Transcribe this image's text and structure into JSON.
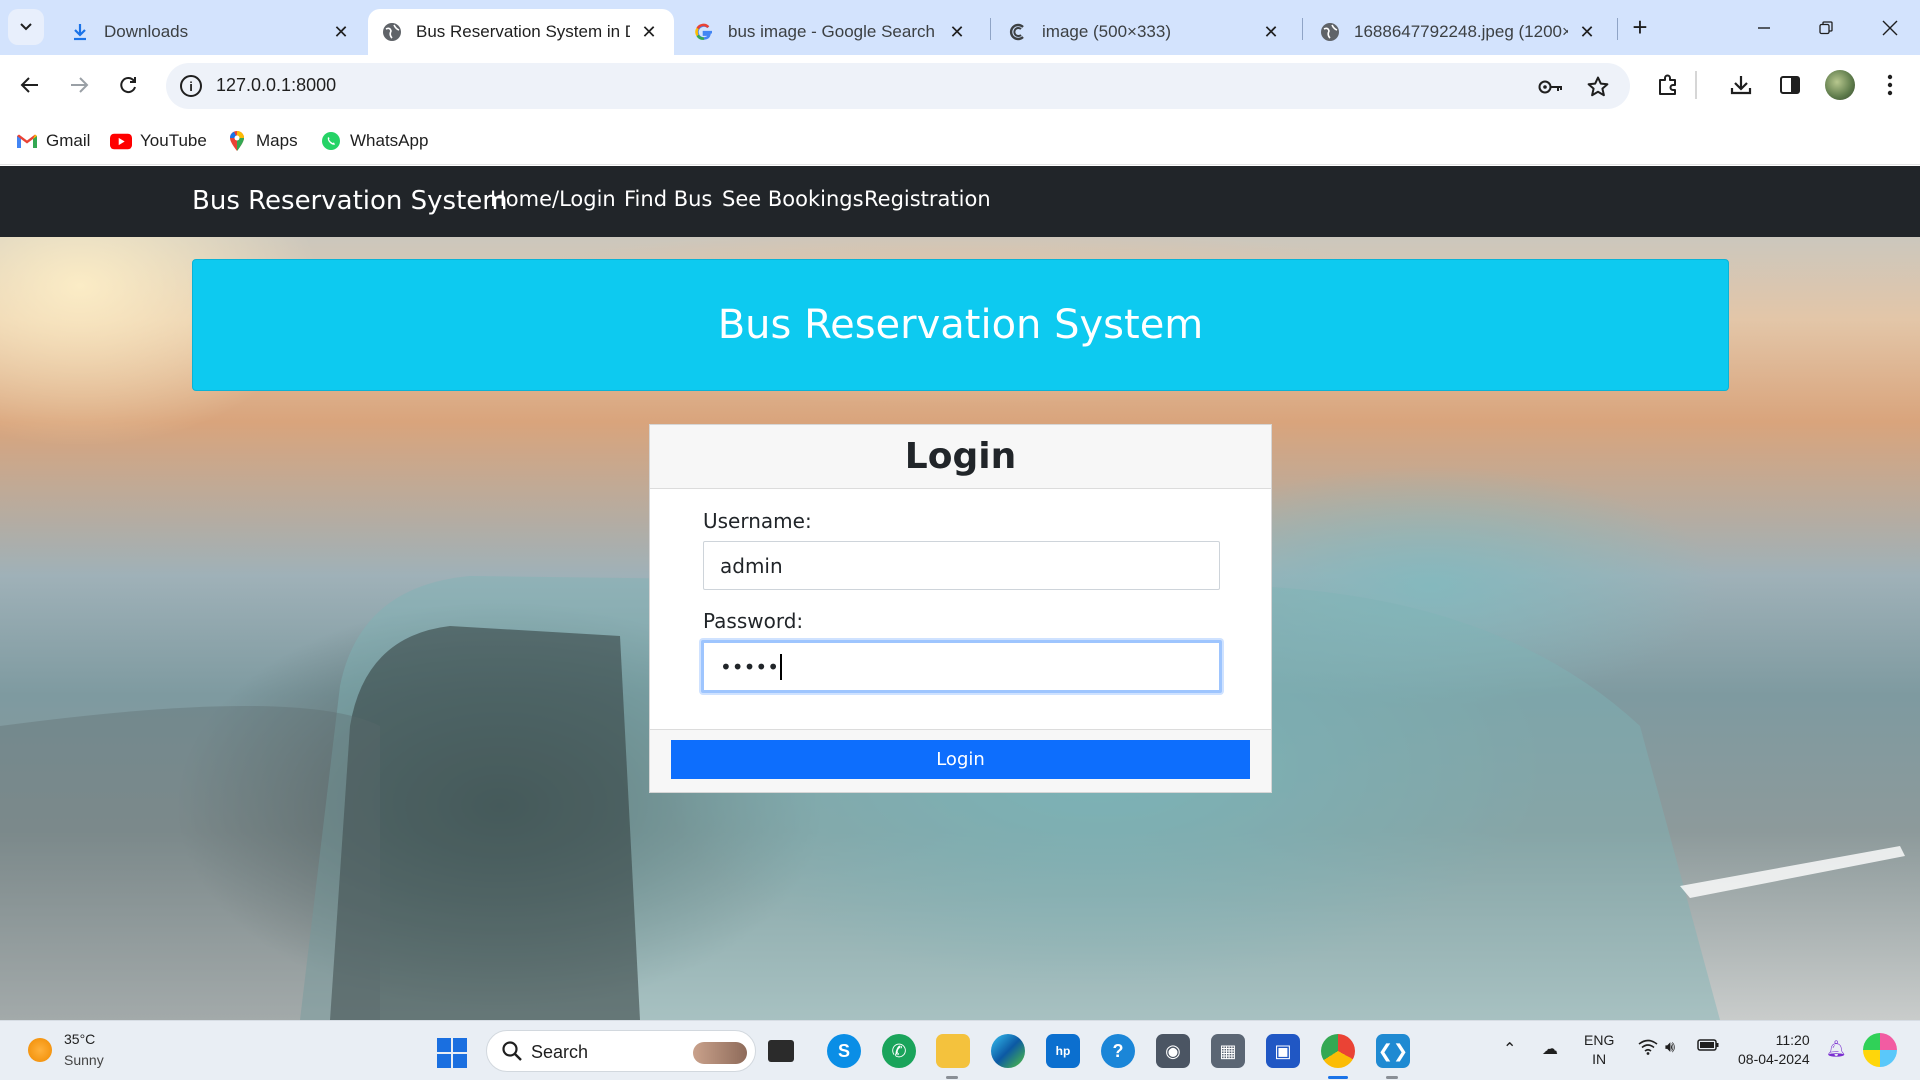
{
  "browser": {
    "tabs": [
      {
        "title": "Downloads",
        "favicon": "download-icon",
        "active": false
      },
      {
        "title": "Bus Reservation System in Dja",
        "favicon": "globe-icon",
        "active": true
      },
      {
        "title": "bus image - Google Search",
        "favicon": "google-icon",
        "active": false
      },
      {
        "title": "image (500×333)",
        "favicon": "loading-icon",
        "active": false
      },
      {
        "title": "1688647792248.jpeg (1200×5",
        "favicon": "globe-icon",
        "active": false
      }
    ],
    "new_tab": "+",
    "url": "127.0.0.1:8000",
    "bookmarks": [
      {
        "label": "Gmail",
        "icon": "gmail-icon"
      },
      {
        "label": "YouTube",
        "icon": "youtube-icon"
      },
      {
        "label": "Maps",
        "icon": "maps-icon"
      },
      {
        "label": "WhatsApp",
        "icon": "whatsapp-icon"
      }
    ]
  },
  "site": {
    "brand": "Bus Reservation System",
    "nav": [
      "Home/Login",
      "Find Bus",
      "See Bookings",
      "Registration"
    ],
    "hero_title": "Bus Reservation System",
    "login": {
      "title": "Login",
      "username_label": "Username:",
      "username_value": "admin",
      "password_label": "Password:",
      "password_value": "•••••",
      "button": "Login"
    }
  },
  "taskbar": {
    "weather_temp": "35°C",
    "weather_condition": "Sunny",
    "search_label": "Search",
    "lang_line1": "ENG",
    "lang_line2": "IN",
    "time": "11:20",
    "date": "08-04-2024"
  },
  "colors": {
    "navbar": "#212529",
    "hero": "#0dcaf0",
    "primary_button": "#0d6efd",
    "tabstrip": "#d3e3fd"
  }
}
